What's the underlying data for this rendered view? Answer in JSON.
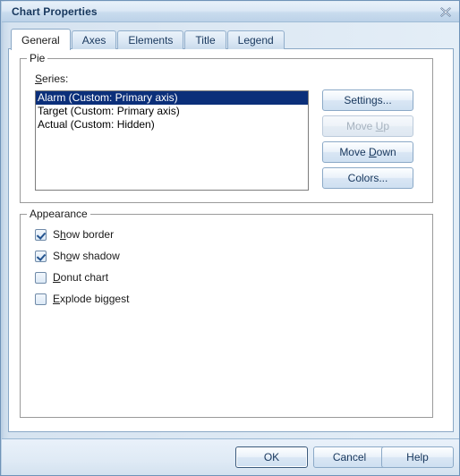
{
  "window": {
    "title": "Chart Properties",
    "close_icon": "close-icon"
  },
  "tabs": [
    {
      "label": "General",
      "active": true
    },
    {
      "label": "Axes",
      "active": false
    },
    {
      "label": "Elements",
      "active": false
    },
    {
      "label": "Title",
      "active": false
    },
    {
      "label": "Legend",
      "active": false
    }
  ],
  "pie_group": {
    "legend": "Pie",
    "series_label": "Series:",
    "series_label_accelerator": "S",
    "series": [
      {
        "text": "Alarm (Custom: Primary axis)",
        "selected": true
      },
      {
        "text": "Target (Custom: Primary axis)",
        "selected": false
      },
      {
        "text": "Actual (Custom: Hidden)",
        "selected": false
      }
    ],
    "buttons": [
      {
        "label": "Settings...",
        "enabled": true,
        "accelerator": ""
      },
      {
        "label": "Move Up",
        "enabled": false,
        "accelerator": "U"
      },
      {
        "label": "Move Down",
        "enabled": true,
        "accelerator": "D"
      },
      {
        "label": "Colors...",
        "enabled": true,
        "accelerator": ""
      }
    ]
  },
  "appearance_group": {
    "legend": "Appearance",
    "checkboxes": [
      {
        "label": "Show border",
        "checked": true,
        "accelerator": "h"
      },
      {
        "label": "Show shadow",
        "checked": true,
        "accelerator": "o"
      },
      {
        "label": "Donut chart",
        "checked": false,
        "accelerator": "D"
      },
      {
        "label": "Explode biggest",
        "checked": false,
        "accelerator": "E"
      }
    ]
  },
  "footer": {
    "buttons": [
      {
        "label": "OK",
        "default": true
      },
      {
        "label": "Cancel",
        "default": false
      },
      {
        "label": "Help",
        "default": false
      }
    ]
  },
  "colors": {
    "title_text": "#16365c",
    "selection_bg": "#0b2f7a",
    "selection_fg": "#ffffff",
    "accent_border": "#8aa8c6"
  }
}
